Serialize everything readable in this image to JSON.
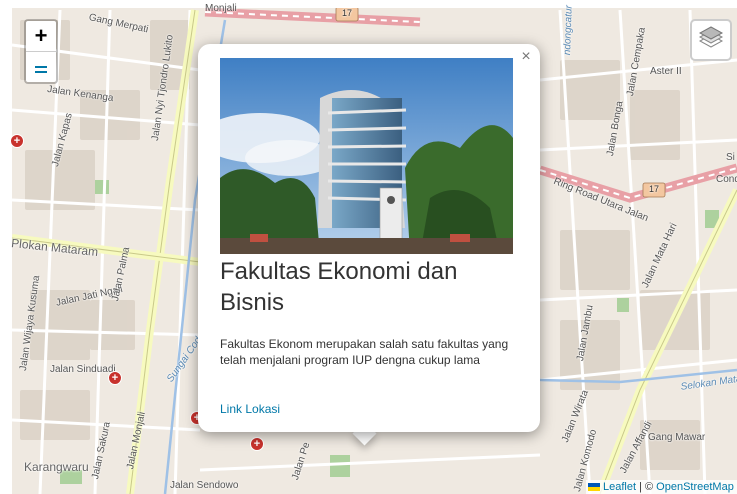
{
  "map": {
    "labels": {
      "monjali": "Monjali",
      "gang_merpati": "Gang Merpati",
      "jalan_kenanga": "Jalan Kenanga",
      "jalan_nyi_tjondro": "Jalan Nyi Tjondro Lukito",
      "jalan_kapas": "Jalan Kapas",
      "plokan_mataram": "Plokan Mataram",
      "jalan_jati_ngali": "Jalan Jati Ngali",
      "jalan_palma": "Jalan Palma",
      "jalan_wijaya_kusuma": "Jalan Wijaya Kusuma",
      "jalan_sinduadi": "Jalan Sinduadi",
      "sungai_code": "Sungai Code",
      "jalan_monjali": "Jalan Monjali",
      "jalan_sakura": "Jalan Sakura",
      "karangwaru": "Karangwaru",
      "jalan_sendowo": "Jalan Sendowo",
      "jalan_pe": "Jalan Pe",
      "ring_road_utara": "Ring Road Utara Jalan",
      "gang_mawar": "Gang Mawar",
      "jalan_affandi": "Jalan Affandi",
      "selokan_mataram": "Selokan Mataram",
      "jalan_wirata": "Jalan Wirata",
      "jalan_komodo": "Jalan Komodo",
      "aster": "Aster II",
      "cond": "Cond",
      "si": "Si",
      "ndongcatur": "ndongcatur",
      "jalan_bonga": "Jalan Bonga",
      "jalan_cempaka": "Jalan Cempaka",
      "jalan_mata": "Jalan Mata Hari",
      "jalan_jambu": "Jalan Jambu",
      "route_17": "17"
    }
  },
  "zoom": {
    "in_label": "+"
  },
  "popup": {
    "close_label": "×",
    "title": "Fakultas Ekonomi dan Bisnis",
    "description": "Fakultas Ekonom merupakan salah satu fakultas yang telah menjalani program IUP dengna cukup lama",
    "link_text": "Link Lokasi"
  },
  "attribution": {
    "leaflet": "Leaflet",
    "separator": " | © ",
    "osm": "OpenStreetMap"
  }
}
